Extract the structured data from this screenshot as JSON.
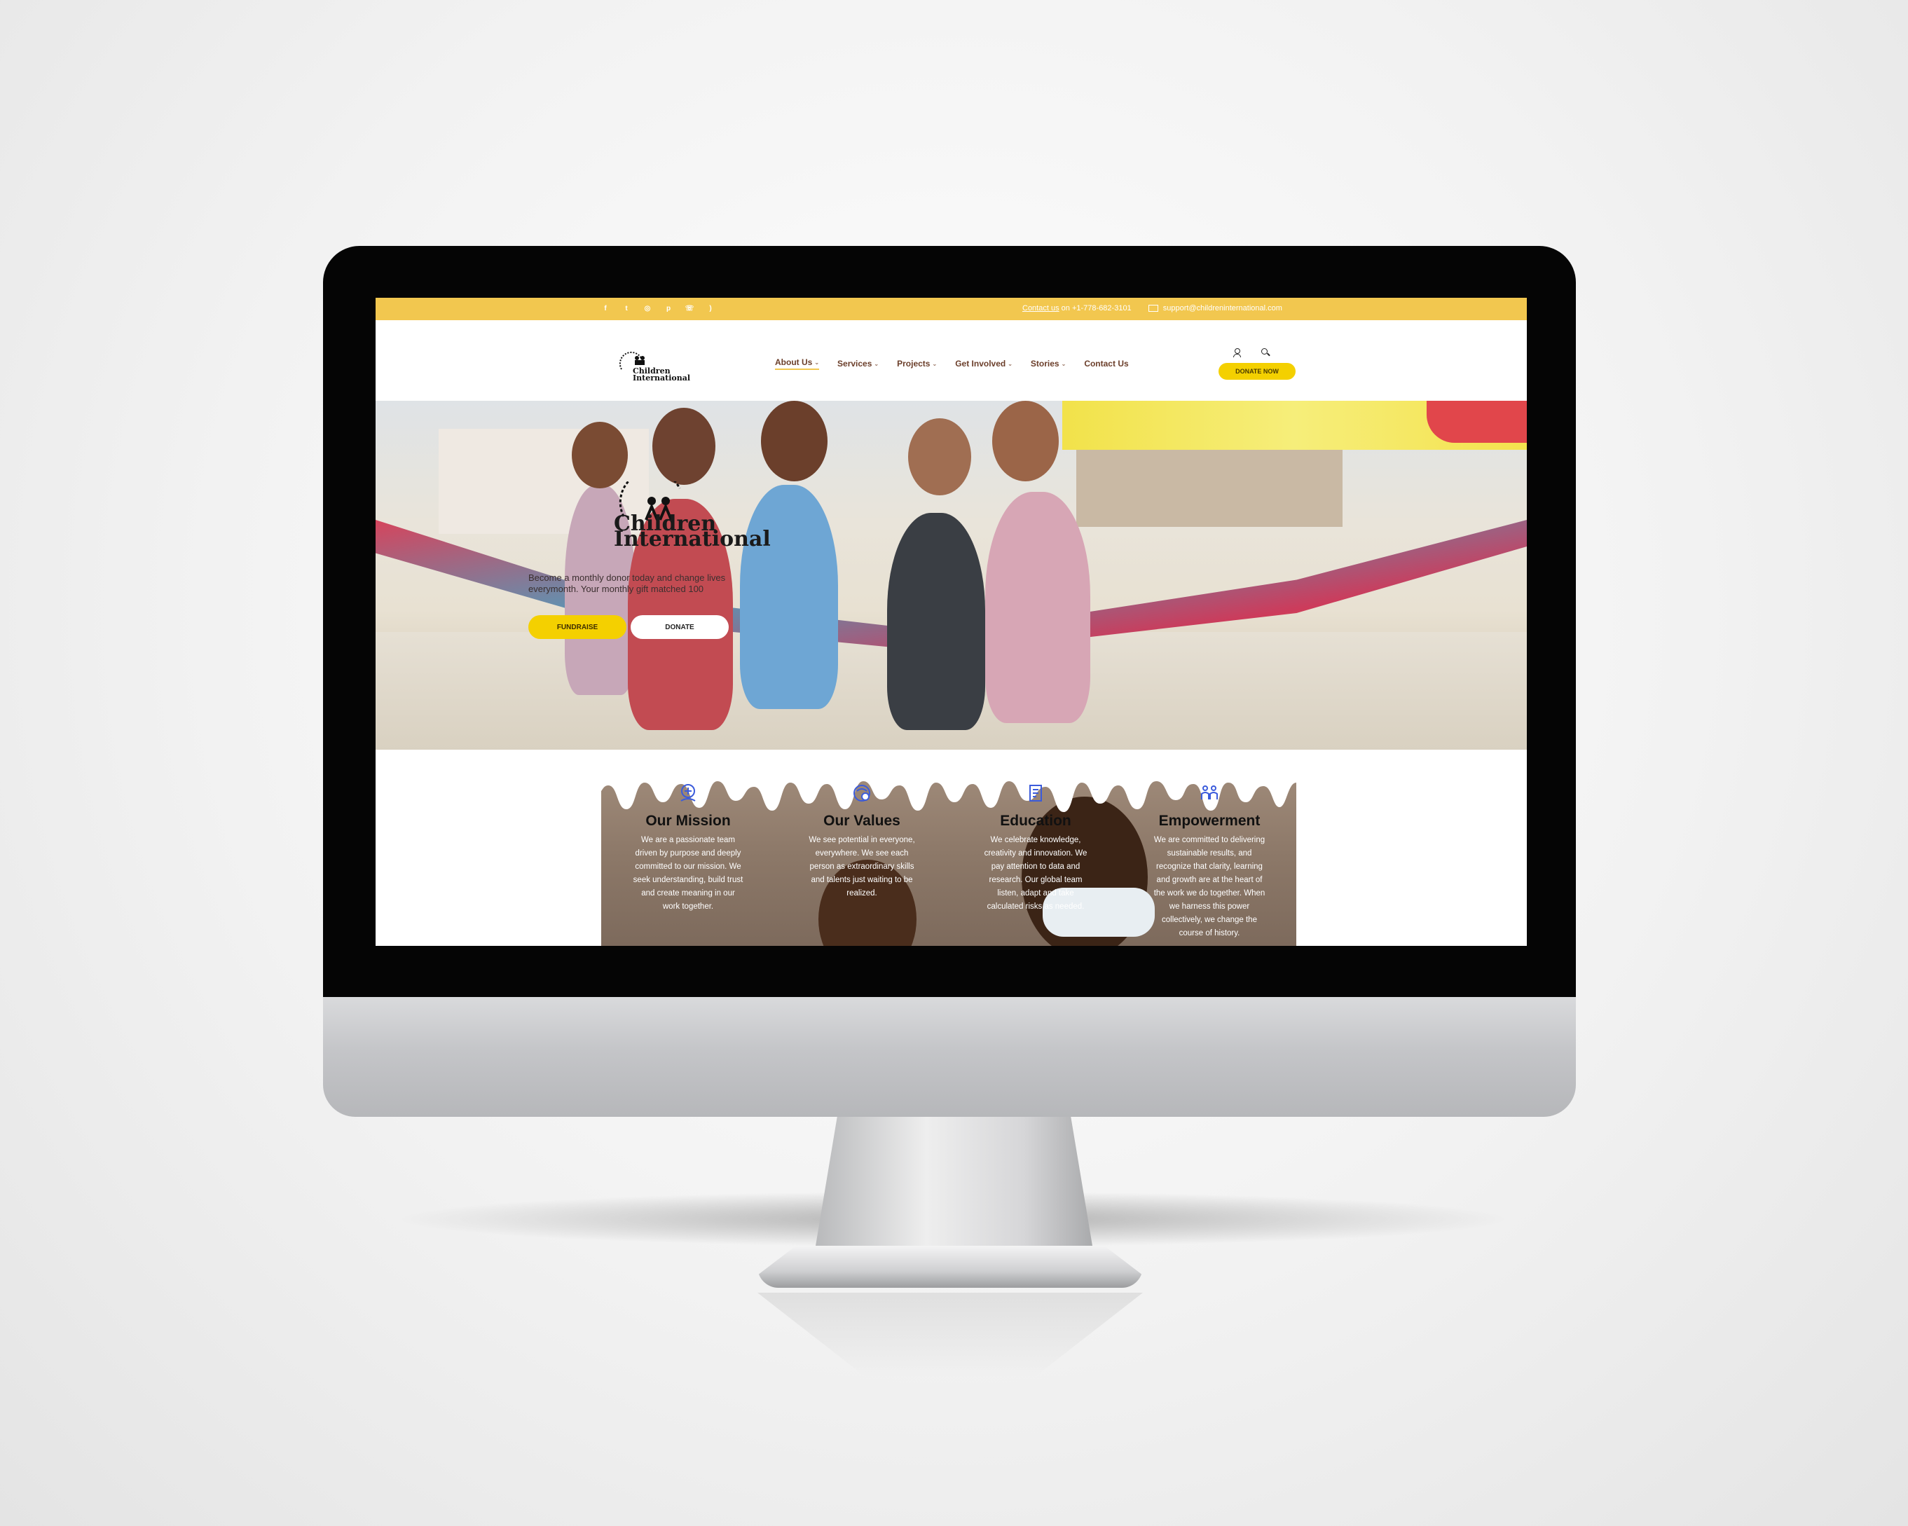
{
  "topbar": {
    "social_icons": [
      "facebook-icon",
      "twitter-icon",
      "instagram-icon",
      "pinterest-icon",
      "whatsapp-icon",
      "rss-icon"
    ],
    "contact_link": "Contact us",
    "contact_on": "on",
    "phone": "+1-778-682-3101",
    "email": "support@childreninternational.com"
  },
  "logo": {
    "line1": "Children",
    "line2": "International"
  },
  "nav": {
    "items": [
      {
        "label": "About Us"
      },
      {
        "label": "Services"
      },
      {
        "label": "Projects"
      },
      {
        "label": "Get Involved"
      },
      {
        "label": "Stories"
      },
      {
        "label": "Contact Us"
      }
    ],
    "donate_label": "DONATE NOW"
  },
  "hero": {
    "logo_line1": "Children",
    "logo_line2": "International",
    "tagline": "Become a monthly donor today and change lives everymonth. Your monthly gift matched 100",
    "fundraise_label": "FUNDRAISE",
    "donate_label": "DONATE"
  },
  "features": [
    {
      "title": "Our Mission",
      "text": "We are a passionate team driven by purpose and deeply committed to our mission. We seek understanding, build trust and create meaning in our work together."
    },
    {
      "title": "Our Values",
      "text": "We see potential in everyone, everywhere. We see each person as extraordinary skills and talents just waiting to be realized."
    },
    {
      "title": "Education",
      "text": "We celebrate knowledge, creativity and innovation. We pay attention to data and research. Our global team listen, adapt and take calculated risks as needed."
    },
    {
      "title": "Empowerment",
      "text": "We are committed to delivering sustainable results, and recognize that clarity, learning and growth are at the heart of the work we do together. When we harness this power collectively, we change the course of history."
    }
  ],
  "colors": {
    "accent": "#f2c74f",
    "button": "#f4d000",
    "nav_text": "#6b3e2a"
  }
}
